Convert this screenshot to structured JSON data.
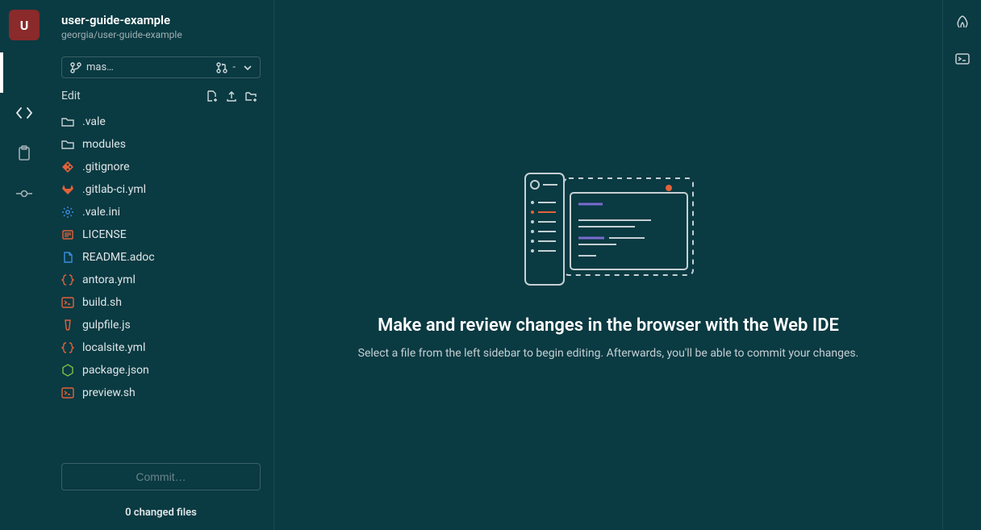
{
  "app_badge": "U",
  "project": {
    "title": "user-guide-example",
    "path": "georgia/user-guide-example"
  },
  "branch": {
    "name": "mas…",
    "mr": "-"
  },
  "edit_section_label": "Edit",
  "tree": [
    {
      "name": ".vale",
      "icon": "folder",
      "color": "#c5d0d4"
    },
    {
      "name": "modules",
      "icon": "folder",
      "color": "#c5d0d4"
    },
    {
      "name": ".gitignore",
      "icon": "git",
      "color": "#e2623a"
    },
    {
      "name": ".gitlab-ci.yml",
      "icon": "gitlab",
      "color": "#e2623a"
    },
    {
      "name": ".vale.ini",
      "icon": "gear",
      "color": "#3a8de0"
    },
    {
      "name": "LICENSE",
      "icon": "license",
      "color": "#e2623a"
    },
    {
      "name": "README.adoc",
      "icon": "doc",
      "color": "#3a8de0"
    },
    {
      "name": "antora.yml",
      "icon": "braces",
      "color": "#e2623a"
    },
    {
      "name": "build.sh",
      "icon": "term",
      "color": "#e2623a"
    },
    {
      "name": "gulpfile.js",
      "icon": "gulp",
      "color": "#e2623a"
    },
    {
      "name": "localsite.yml",
      "icon": "braces",
      "color": "#e2623a"
    },
    {
      "name": "package.json",
      "icon": "node",
      "color": "#7fbf4a"
    },
    {
      "name": "preview.sh",
      "icon": "term",
      "color": "#e2623a"
    }
  ],
  "commit_button": "Commit…",
  "changed_files": "0 changed files",
  "hero": {
    "title": "Make and review changes in the browser with the Web IDE",
    "subtitle": "Select a file from the left sidebar to begin editing. Afterwards, you'll be able to commit your changes."
  }
}
